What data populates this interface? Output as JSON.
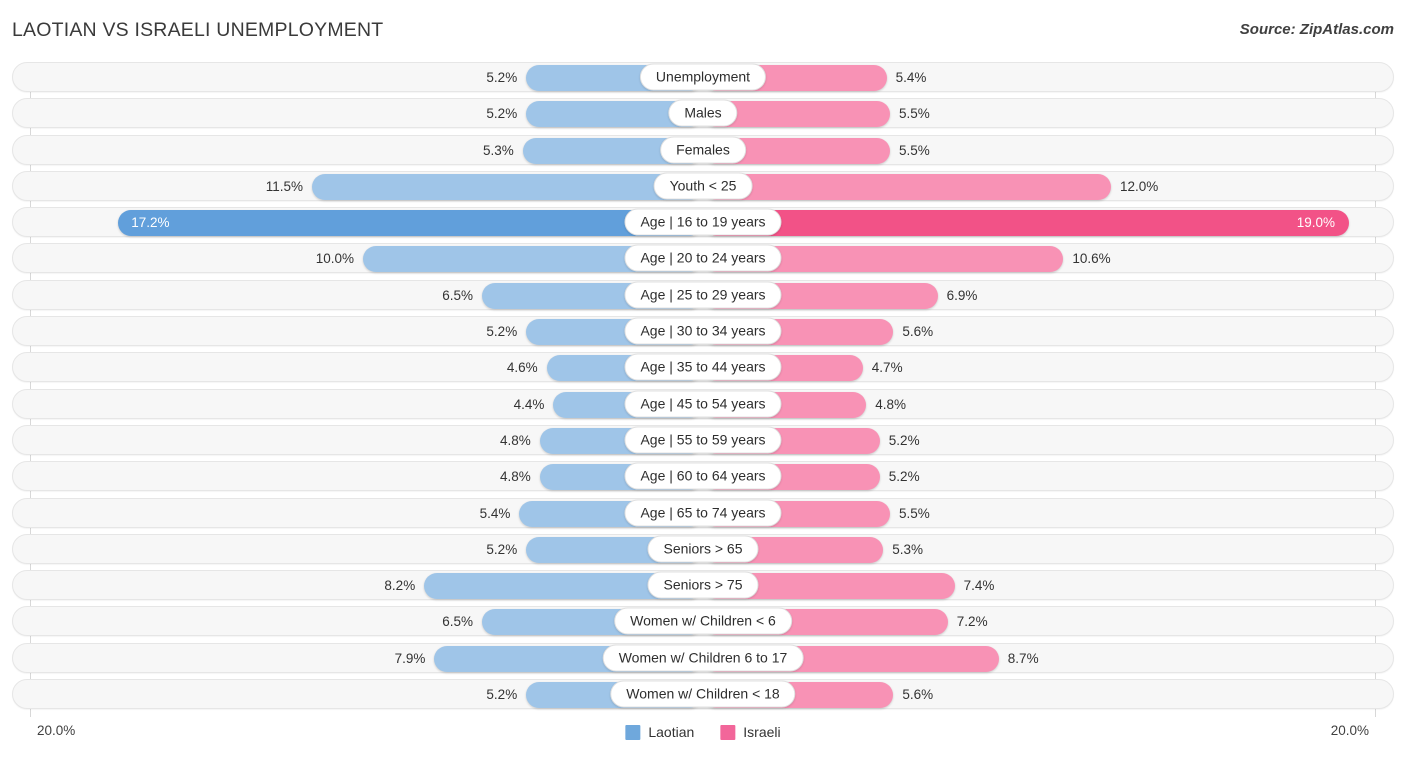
{
  "header": {
    "title": "LAOTIAN VS ISRAELI UNEMPLOYMENT",
    "source": "Source: ZipAtlas.com"
  },
  "axis": {
    "left_label": "20.0%",
    "right_label": "20.0%",
    "max": 20.0
  },
  "legend": {
    "items": [
      {
        "label": "Laotian",
        "color": "#6fa8dc"
      },
      {
        "label": "Israeli",
        "color": "#f2669a"
      }
    ]
  },
  "colors": {
    "left_bar": "#9fc5e8",
    "left_bar_highlight": "#619fdb",
    "right_bar": "#f892b5",
    "right_bar_highlight": "#f25287",
    "row_background": "#f7f7f7",
    "gridline": "#d8d8d8"
  },
  "chart_data": {
    "type": "bar",
    "title": "LAOTIAN VS ISRAELI UNEMPLOYMENT",
    "subtitle": "Source: ZipAtlas.com",
    "orientation": "horizontal-diverging",
    "xlabel": "",
    "ylabel": "",
    "xlim": [
      20.0,
      20.0
    ],
    "grid": true,
    "legend_position": "bottom-center",
    "categories": [
      "Unemployment",
      "Males",
      "Females",
      "Youth < 25",
      "Age | 16 to 19 years",
      "Age | 20 to 24 years",
      "Age | 25 to 29 years",
      "Age | 30 to 34 years",
      "Age | 35 to 44 years",
      "Age | 45 to 54 years",
      "Age | 55 to 59 years",
      "Age | 60 to 64 years",
      "Age | 65 to 74 years",
      "Seniors > 65",
      "Seniors > 75",
      "Women w/ Children < 6",
      "Women w/ Children 6 to 17",
      "Women w/ Children < 18"
    ],
    "series": [
      {
        "name": "Laotian",
        "color": "#6fa8dc",
        "values": [
          5.2,
          5.2,
          5.3,
          11.5,
          17.2,
          10.0,
          6.5,
          5.2,
          4.6,
          4.4,
          4.8,
          4.8,
          5.4,
          5.2,
          8.2,
          6.5,
          7.9,
          5.2
        ],
        "labels": [
          "5.2%",
          "5.2%",
          "5.3%",
          "11.5%",
          "17.2%",
          "10.0%",
          "6.5%",
          "5.2%",
          "4.6%",
          "4.4%",
          "4.8%",
          "4.8%",
          "5.4%",
          "5.2%",
          "8.2%",
          "6.5%",
          "7.9%",
          "5.2%"
        ]
      },
      {
        "name": "Israeli",
        "color": "#f2669a",
        "values": [
          5.4,
          5.5,
          5.5,
          12.0,
          19.0,
          10.6,
          6.9,
          5.6,
          4.7,
          4.8,
          5.2,
          5.2,
          5.5,
          5.3,
          7.4,
          7.2,
          8.7,
          5.6
        ],
        "labels": [
          "5.4%",
          "5.5%",
          "5.5%",
          "12.0%",
          "19.0%",
          "10.6%",
          "6.9%",
          "5.6%",
          "4.7%",
          "4.8%",
          "5.2%",
          "5.2%",
          "5.5%",
          "5.3%",
          "7.4%",
          "7.2%",
          "8.7%",
          "5.6%"
        ]
      }
    ],
    "highlighted_row": "Age | 16 to 19 years"
  }
}
